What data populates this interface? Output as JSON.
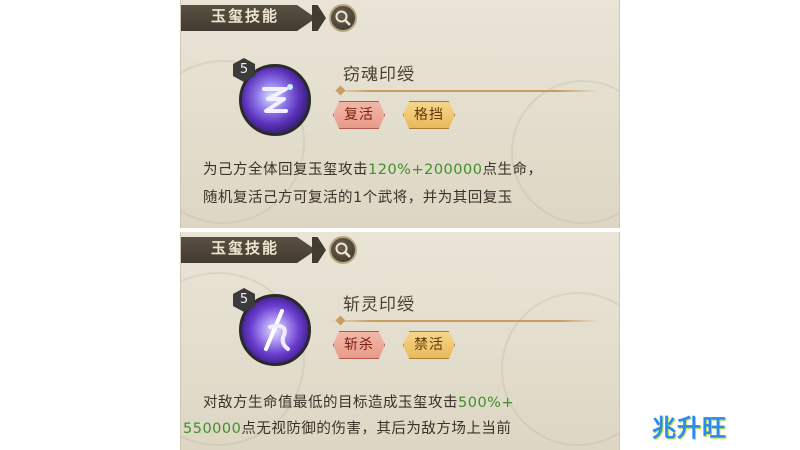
{
  "panels": [
    {
      "header": "玉玺技能",
      "level": "5",
      "skill_name": "窃魂印绶",
      "tags": [
        "复活",
        "格挡"
      ],
      "desc_line1_pre": "为己方全体回复玉玺攻击",
      "desc_line1_hl": "120%+200000",
      "desc_line1_post": "点生命，",
      "desc_line2": "随机复活己方可复活的1个武将，并为其回复玉"
    },
    {
      "header": "玉玺技能",
      "level": "5",
      "skill_name": "斩灵印绶",
      "tags": [
        "斩杀",
        "禁活"
      ],
      "desc_line1_pre": "对敌方生命值最低的目标造成玉玺攻击",
      "desc_line1_hl": "500%+",
      "desc_line2_hl": "550000",
      "desc_line2_post": "点无视防御的伤害，其后为敌方场上当前"
    }
  ],
  "watermark": "兆升旺",
  "icons": {
    "search": "magnifier-icon",
    "gem1": "soul-seal-gem-icon",
    "gem2": "spirit-slash-seal-gem-icon"
  },
  "colors": {
    "highlight": "#3f8f2e",
    "tag_red": "#e89b8a",
    "tag_gold": "#e9b95a",
    "header_bg": "#433b30"
  }
}
